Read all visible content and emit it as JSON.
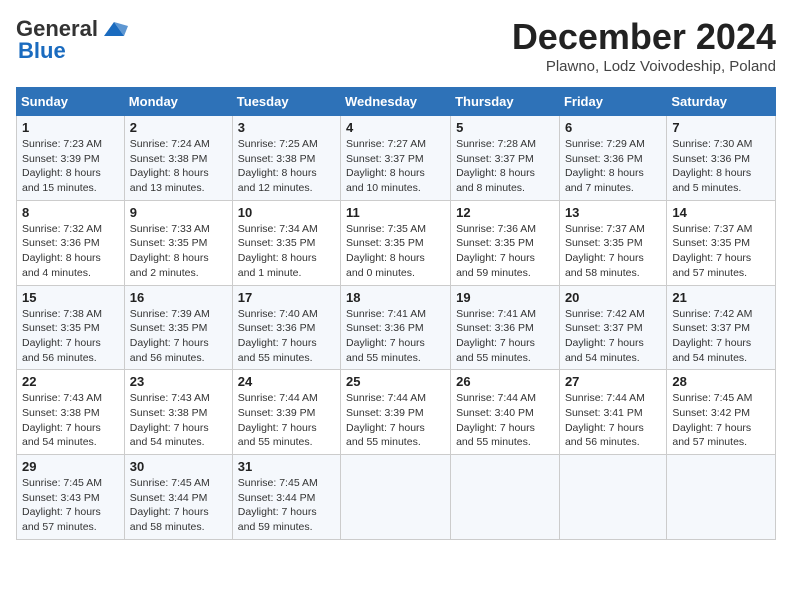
{
  "header": {
    "logo_general": "General",
    "logo_blue": "Blue",
    "month_title": "December 2024",
    "location": "Plawno, Lodz Voivodeship, Poland"
  },
  "calendar": {
    "days_of_week": [
      "Sunday",
      "Monday",
      "Tuesday",
      "Wednesday",
      "Thursday",
      "Friday",
      "Saturday"
    ],
    "weeks": [
      [
        {
          "day": "1",
          "sunrise": "7:23 AM",
          "sunset": "3:39 PM",
          "daylight": "8 hours and 15 minutes."
        },
        {
          "day": "2",
          "sunrise": "7:24 AM",
          "sunset": "3:38 PM",
          "daylight": "8 hours and 13 minutes."
        },
        {
          "day": "3",
          "sunrise": "7:25 AM",
          "sunset": "3:38 PM",
          "daylight": "8 hours and 12 minutes."
        },
        {
          "day": "4",
          "sunrise": "7:27 AM",
          "sunset": "3:37 PM",
          "daylight": "8 hours and 10 minutes."
        },
        {
          "day": "5",
          "sunrise": "7:28 AM",
          "sunset": "3:37 PM",
          "daylight": "8 hours and 8 minutes."
        },
        {
          "day": "6",
          "sunrise": "7:29 AM",
          "sunset": "3:36 PM",
          "daylight": "8 hours and 7 minutes."
        },
        {
          "day": "7",
          "sunrise": "7:30 AM",
          "sunset": "3:36 PM",
          "daylight": "8 hours and 5 minutes."
        }
      ],
      [
        {
          "day": "8",
          "sunrise": "7:32 AM",
          "sunset": "3:36 PM",
          "daylight": "8 hours and 4 minutes."
        },
        {
          "day": "9",
          "sunrise": "7:33 AM",
          "sunset": "3:35 PM",
          "daylight": "8 hours and 2 minutes."
        },
        {
          "day": "10",
          "sunrise": "7:34 AM",
          "sunset": "3:35 PM",
          "daylight": "8 hours and 1 minute."
        },
        {
          "day": "11",
          "sunrise": "7:35 AM",
          "sunset": "3:35 PM",
          "daylight": "8 hours and 0 minutes."
        },
        {
          "day": "12",
          "sunrise": "7:36 AM",
          "sunset": "3:35 PM",
          "daylight": "7 hours and 59 minutes."
        },
        {
          "day": "13",
          "sunrise": "7:37 AM",
          "sunset": "3:35 PM",
          "daylight": "7 hours and 58 minutes."
        },
        {
          "day": "14",
          "sunrise": "7:37 AM",
          "sunset": "3:35 PM",
          "daylight": "7 hours and 57 minutes."
        }
      ],
      [
        {
          "day": "15",
          "sunrise": "7:38 AM",
          "sunset": "3:35 PM",
          "daylight": "7 hours and 56 minutes."
        },
        {
          "day": "16",
          "sunrise": "7:39 AM",
          "sunset": "3:35 PM",
          "daylight": "7 hours and 56 minutes."
        },
        {
          "day": "17",
          "sunrise": "7:40 AM",
          "sunset": "3:36 PM",
          "daylight": "7 hours and 55 minutes."
        },
        {
          "day": "18",
          "sunrise": "7:41 AM",
          "sunset": "3:36 PM",
          "daylight": "7 hours and 55 minutes."
        },
        {
          "day": "19",
          "sunrise": "7:41 AM",
          "sunset": "3:36 PM",
          "daylight": "7 hours and 55 minutes."
        },
        {
          "day": "20",
          "sunrise": "7:42 AM",
          "sunset": "3:37 PM",
          "daylight": "7 hours and 54 minutes."
        },
        {
          "day": "21",
          "sunrise": "7:42 AM",
          "sunset": "3:37 PM",
          "daylight": "7 hours and 54 minutes."
        }
      ],
      [
        {
          "day": "22",
          "sunrise": "7:43 AM",
          "sunset": "3:38 PM",
          "daylight": "7 hours and 54 minutes."
        },
        {
          "day": "23",
          "sunrise": "7:43 AM",
          "sunset": "3:38 PM",
          "daylight": "7 hours and 54 minutes."
        },
        {
          "day": "24",
          "sunrise": "7:44 AM",
          "sunset": "3:39 PM",
          "daylight": "7 hours and 55 minutes."
        },
        {
          "day": "25",
          "sunrise": "7:44 AM",
          "sunset": "3:39 PM",
          "daylight": "7 hours and 55 minutes."
        },
        {
          "day": "26",
          "sunrise": "7:44 AM",
          "sunset": "3:40 PM",
          "daylight": "7 hours and 55 minutes."
        },
        {
          "day": "27",
          "sunrise": "7:44 AM",
          "sunset": "3:41 PM",
          "daylight": "7 hours and 56 minutes."
        },
        {
          "day": "28",
          "sunrise": "7:45 AM",
          "sunset": "3:42 PM",
          "daylight": "7 hours and 57 minutes."
        }
      ],
      [
        {
          "day": "29",
          "sunrise": "7:45 AM",
          "sunset": "3:43 PM",
          "daylight": "7 hours and 57 minutes."
        },
        {
          "day": "30",
          "sunrise": "7:45 AM",
          "sunset": "3:44 PM",
          "daylight": "7 hours and 58 minutes."
        },
        {
          "day": "31",
          "sunrise": "7:45 AM",
          "sunset": "3:44 PM",
          "daylight": "7 hours and 59 minutes."
        },
        null,
        null,
        null,
        null
      ]
    ]
  }
}
